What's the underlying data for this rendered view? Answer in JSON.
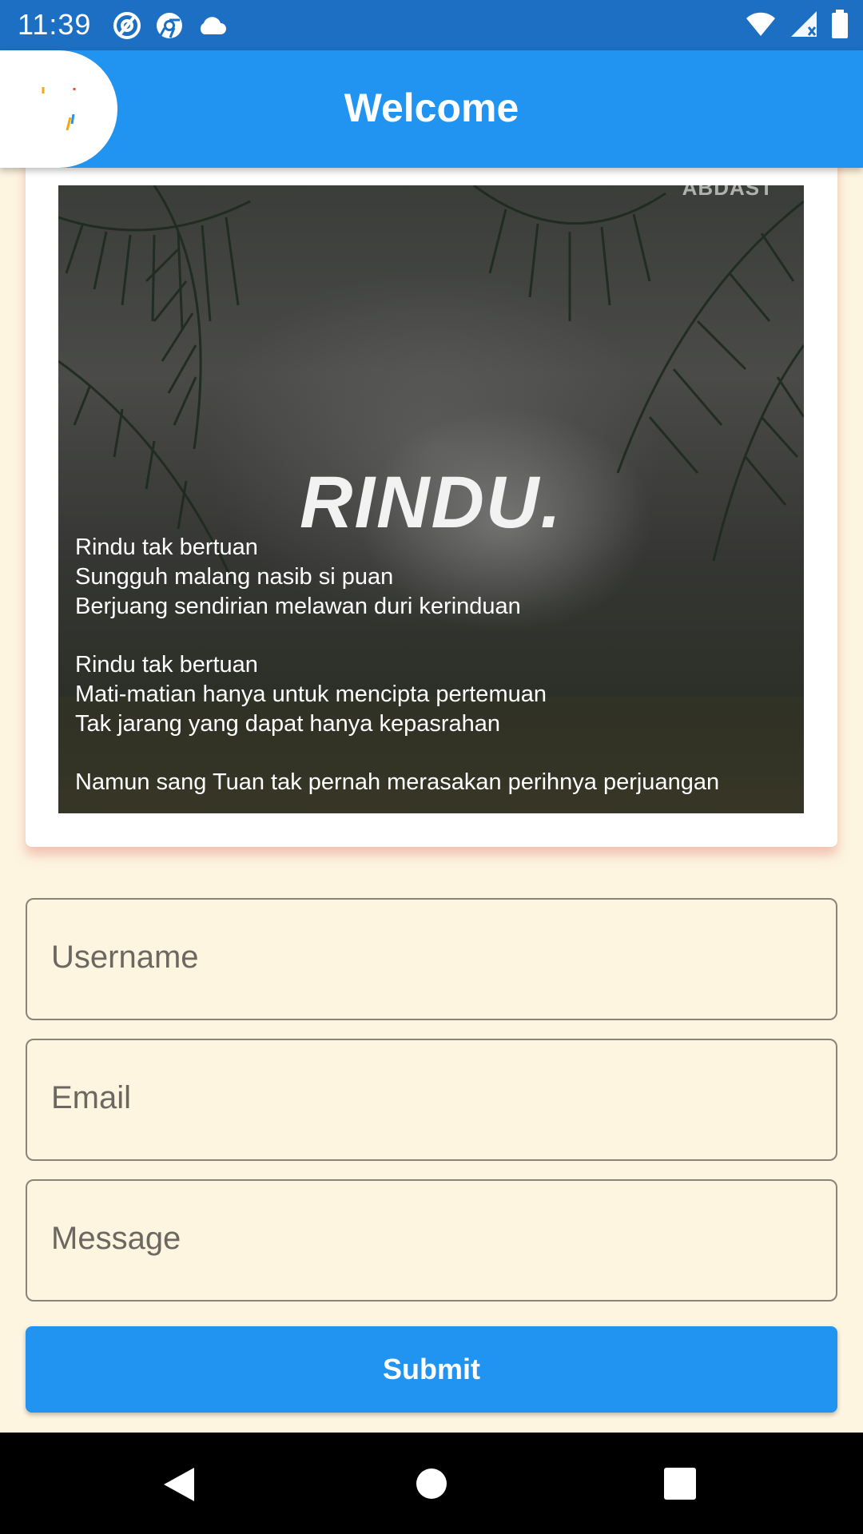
{
  "status_bar": {
    "time": "11:39",
    "left_icons": [
      "at-sign-icon",
      "chrome-icon",
      "cloud-icon"
    ],
    "right_icons": [
      "wifi-icon",
      "signal-icon",
      "battery-icon"
    ]
  },
  "app_bar": {
    "title": "Welcome",
    "logo": "logo-icon"
  },
  "poster": {
    "brand": "ABDAST",
    "title": "RINDU.",
    "stanzas": [
      [
        "Rindu tak bertuan",
        "Sungguh malang nasib si puan",
        "Berjuang sendirian melawan duri kerinduan"
      ],
      [
        "Rindu tak bertuan",
        "Mati-matian hanya untuk mencipta pertemuan",
        "Tak jarang yang dapat hanya kepasrahan"
      ],
      [
        "Namun sang Tuan tak pernah merasakan perihnya perjuangan"
      ]
    ]
  },
  "form": {
    "username_placeholder": "Username",
    "email_placeholder": "Email",
    "message_placeholder": "Message",
    "submit_label": "Submit"
  },
  "nav_bar": {
    "icons": [
      "back-icon",
      "home-icon",
      "recents-icon"
    ]
  },
  "colors": {
    "status_bar": "#1c6fc2",
    "app_bar": "#2193f0",
    "background": "#fdf5e0",
    "button": "#2193f0"
  }
}
